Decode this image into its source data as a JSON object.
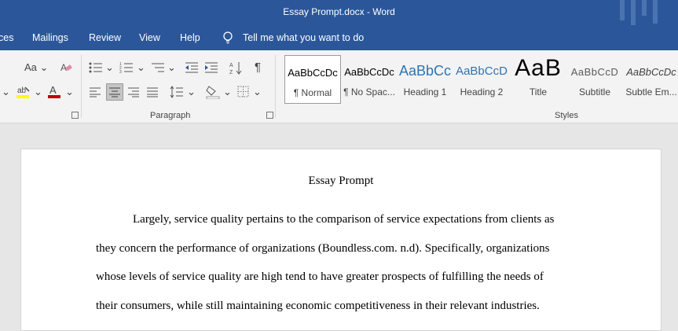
{
  "window": {
    "title": "Essay Prompt.docx  -  Word"
  },
  "menu": {
    "items": [
      "ces",
      "Mailings",
      "Review",
      "View",
      "Help"
    ],
    "tell_me": "Tell me what you want to do"
  },
  "ribbon": {
    "font_group": {
      "change_case": "Aa"
    },
    "paragraph_label": "Paragraph",
    "styles_label": "Styles",
    "styles": [
      {
        "preview": "AaBbCcDc",
        "name": "¶ Normal",
        "selected": true
      },
      {
        "preview": "AaBbCcDc",
        "name": "¶ No Spac..."
      },
      {
        "preview": "AaBbCc",
        "name": "Heading 1"
      },
      {
        "preview": "AaBbCcD",
        "name": "Heading 2"
      },
      {
        "preview": "AaB",
        "name": "Title"
      },
      {
        "preview": "AaBbCcD",
        "name": "Subtitle"
      },
      {
        "preview": "AaBbCcDc",
        "name": "Subtle Em..."
      }
    ]
  },
  "document": {
    "title": "Essay Prompt",
    "lines": [
      "Largely, service quality pertains to the comparison of service expectations from clients as",
      "they concern the performance of organizations (Boundless.com. n.d). Specifically, organizations",
      "whose levels of service quality are high tend to have greater prospects of fulfilling the needs of",
      "their consumers, while still maintaining economic competitiveness in their relevant industries."
    ]
  },
  "colors": {
    "titlebar": "#2b579a",
    "ribbon": "#f3f3f3",
    "page": "#ffffff",
    "font_color_bar": "#c00000",
    "highlight_bar": "#ffff00"
  }
}
